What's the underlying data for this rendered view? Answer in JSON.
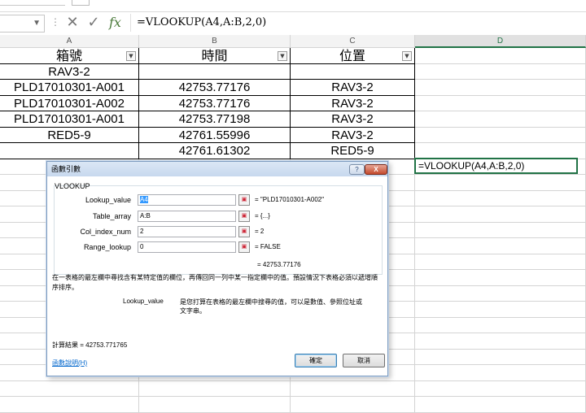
{
  "formula_bar": {
    "name_box": "",
    "cancel_glyph": "✕",
    "enter_glyph": "✓",
    "fx": "fx",
    "formula": "=VLOOKUP(A4,A:B,2,0)"
  },
  "columns": [
    "A",
    "B",
    "C",
    "D"
  ],
  "headers": {
    "a": "箱號",
    "b": "時間",
    "c": "位置"
  },
  "rows": [
    {
      "a": "RAV3-2",
      "b": "",
      "c": ""
    },
    {
      "a": "PLD17010301-A001",
      "b": "42753.77176",
      "c": "RAV3-2"
    },
    {
      "a": "PLD17010301-A002",
      "b": "42753.77176",
      "c": "RAV3-2"
    },
    {
      "a": "PLD17010301-A001",
      "b": "42753.77198",
      "c": "RAV3-2"
    },
    {
      "a": "RED5-9",
      "b": "42761.55996",
      "c": "RAV3-2"
    },
    {
      "a": "",
      "b": "42761.61302",
      "c": "RED5-9"
    }
  ],
  "active_cell_formula": "=VLOOKUP(A4,A:B,2,0)",
  "dialog": {
    "title": "函數引數",
    "help_glyph": "?",
    "close_glyph": "X",
    "function_name": "VLOOKUP",
    "args": [
      {
        "label": "Lookup_value",
        "value": "A4",
        "result": "= \"PLD17010301-A002\""
      },
      {
        "label": "Table_array",
        "value": "A:B",
        "result": "= {...}"
      },
      {
        "label": "Col_index_num",
        "value": "2",
        "result": "= 2"
      },
      {
        "label": "Range_lookup",
        "value": "0",
        "result": "= FALSE"
      }
    ],
    "formula_result": "= 42753.77176",
    "description": "在一表格的最左欄中尋找含有某特定值的欄位，再傳回同一列中某一指定欄中的值。預設情況下表格必須以遞增順序排序。",
    "arg_desc_label": "Lookup_value",
    "arg_desc_text": "是您打算在表格的最左欄中搜尋的值，可以是數值、參照位址或文字串。",
    "calc_result": "計算結果 =    42753.771765",
    "help_link": "函數說明(H)",
    "ok": "確定",
    "cancel": "取消"
  }
}
